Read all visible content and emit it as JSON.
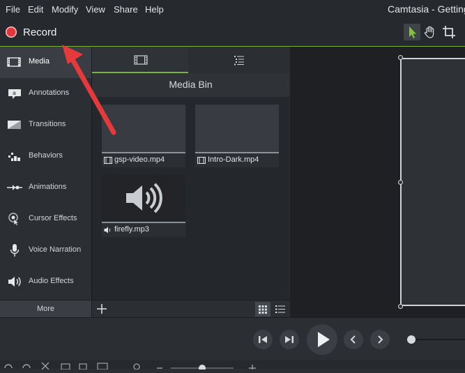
{
  "menu": {
    "items": [
      "File",
      "Edit",
      "Modify",
      "View",
      "Share",
      "Help"
    ],
    "app_title": "Camtasia - Getting"
  },
  "record": {
    "label": "Record"
  },
  "sidebar": {
    "items": [
      {
        "label": "Media",
        "icon": "film-icon"
      },
      {
        "label": "Annotations",
        "icon": "annotation-icon"
      },
      {
        "label": "Transitions",
        "icon": "transition-icon"
      },
      {
        "label": "Behaviors",
        "icon": "behaviors-icon"
      },
      {
        "label": "Animations",
        "icon": "animation-icon"
      },
      {
        "label": "Cursor Effects",
        "icon": "cursor-icon"
      },
      {
        "label": "Voice Narration",
        "icon": "microphone-icon"
      },
      {
        "label": "Audio Effects",
        "icon": "speaker-icon"
      }
    ],
    "more_label": "More"
  },
  "media_panel": {
    "title": "Media Bin",
    "clips": [
      {
        "name": "gsp-video.mp4",
        "type": "video"
      },
      {
        "name": "Intro-Dark.mp4",
        "type": "video"
      },
      {
        "name": "firefly.mp3",
        "type": "audio"
      }
    ]
  },
  "colors": {
    "accent": "#7ab23a",
    "record": "#e2363b",
    "arrow": "#e5393b"
  }
}
